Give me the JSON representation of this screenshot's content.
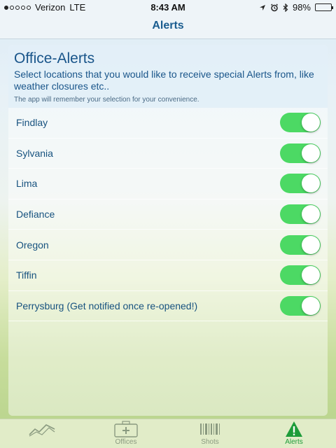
{
  "statusbar": {
    "carrier": "Verizon",
    "network": "LTE",
    "time": "8:43 AM",
    "battery": "98%",
    "battery_level": 0.98
  },
  "navbar": {
    "title": "Alerts"
  },
  "header": {
    "title": "Office-Alerts",
    "subtitle": "Select locations that you would like to receive special Alerts from, like weather closures etc..",
    "note": "The app will remember your selection for your convenience."
  },
  "locations": [
    {
      "label": "Findlay",
      "enabled": true
    },
    {
      "label": "Sylvania",
      "enabled": true
    },
    {
      "label": "Lima",
      "enabled": true
    },
    {
      "label": "Defiance",
      "enabled": true
    },
    {
      "label": "Oregon",
      "enabled": true
    },
    {
      "label": "Tiffin",
      "enabled": true
    },
    {
      "label": "Perrysburg (Get notified once re-opened!)",
      "enabled": true
    }
  ],
  "tabs": [
    {
      "label": "",
      "icon": "chart-line-icon",
      "active": false
    },
    {
      "label": "Offices",
      "icon": "first-aid-kit-icon",
      "active": false
    },
    {
      "label": "Shots",
      "icon": "barcode-icon",
      "active": false
    },
    {
      "label": "Alerts",
      "icon": "warning-icon",
      "active": true
    }
  ],
  "colors": {
    "accent": "#1a5c8f",
    "toggle_on": "#4cd964",
    "tab_active": "#1e9c3a"
  }
}
